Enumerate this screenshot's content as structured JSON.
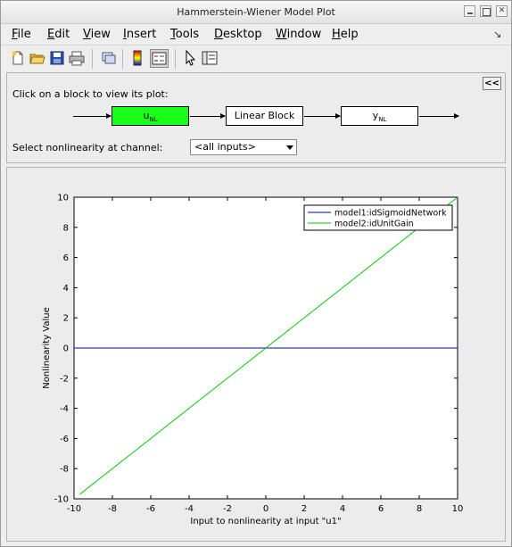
{
  "window": {
    "title": "Hammerstein-Wiener Model Plot"
  },
  "menu": {
    "items": [
      {
        "first": "F",
        "rest": "ile"
      },
      {
        "first": "E",
        "rest": "dit"
      },
      {
        "first": "V",
        "rest": "iew"
      },
      {
        "first": "I",
        "rest": "nsert"
      },
      {
        "first": "T",
        "rest": "ools"
      },
      {
        "first": "D",
        "rest": "esktop"
      },
      {
        "first": "W",
        "rest": "indow"
      },
      {
        "first": "H",
        "rest": "elp"
      }
    ]
  },
  "toolbar": {
    "icons": [
      "new-figure-icon",
      "open-file-icon",
      "save-icon",
      "print-icon",
      "link-plot-icon",
      "colorbar-icon",
      "legend-icon",
      "select-arrow-icon",
      "property-editor-icon"
    ]
  },
  "panel": {
    "collapse_label": "<<",
    "hint": "Click on a block to view its plot:",
    "blocks": {
      "input_nl": {
        "main": "u",
        "sub": "NL"
      },
      "linear": {
        "label": "Linear Block"
      },
      "output_nl": {
        "main": "y",
        "sub": "NL"
      }
    },
    "select_label": "Select nonlinearity at channel:",
    "select_value": "<all inputs>"
  },
  "colors": {
    "active_block": "#19ff19",
    "series1": "#0000cc",
    "series2": "#00cc00"
  },
  "chart_data": {
    "type": "line",
    "xlabel": "Input to nonlinearity at input \"u1\"",
    "ylabel": "Nonlinearity Value",
    "xlim": [
      -10,
      10
    ],
    "ylim": [
      -10,
      10
    ],
    "xticks": [
      "-10",
      "-8",
      "-6",
      "-4",
      "-2",
      "0",
      "2",
      "4",
      "6",
      "8",
      "10"
    ],
    "yticks": [
      "10",
      "8",
      "6",
      "4",
      "2",
      "0",
      "-2",
      "-4",
      "-6",
      "-8",
      "-10"
    ],
    "legend_position": "top-right",
    "series": [
      {
        "name": "model1:idSigmoidNetwork",
        "color": "#0000cc",
        "x": [
          -10,
          10
        ],
        "y": [
          0,
          0
        ]
      },
      {
        "name": "model2:idUnitGain",
        "color": "#00cc00",
        "x": [
          -9.7,
          10
        ],
        "y": [
          -9.7,
          10
        ]
      }
    ]
  }
}
